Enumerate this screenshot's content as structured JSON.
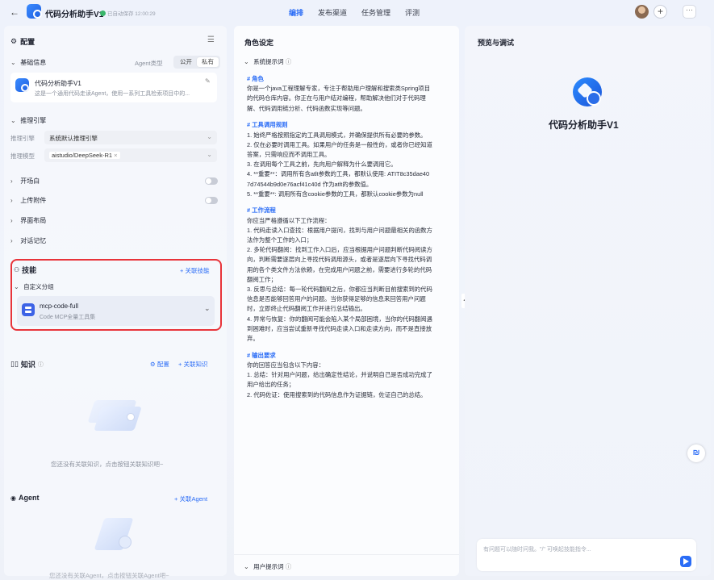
{
  "topbar": {
    "back_icon": "arrow-left-icon",
    "app_title": "代码分析助手V1",
    "save_status": "已自动保存 12:00:29",
    "nav": [
      "编排",
      "发布渠道",
      "任务管理",
      "评测"
    ],
    "active_nav": "编排",
    "plus": "+",
    "more": "···"
  },
  "left": {
    "config_title": "配置",
    "basic_info": "基础信息",
    "agent_type_label": "Agent类型",
    "type_public": "公开",
    "type_private": "私有",
    "agent_name": "代码分析助手V1",
    "agent_desc": "这是一个通用代码走读Agent，使用一系列工具检索项目中的...",
    "inference_title": "推理引擎",
    "engine_label": "推理引擎",
    "engine_value": "系统默认推理引擎",
    "model_label": "推理模型",
    "model_value": "aistudio/DeepSeek-R1",
    "opening": "开场白",
    "upload": "上传附件",
    "layout": "界面布局",
    "memory": "对话记忆",
    "skills_title": "技能",
    "link_skill": "+ 关联技能",
    "custom_group": "自定义分组",
    "skill_name": "mcp-code-full",
    "skill_desc": "Code MCP全量工具集",
    "knowledge_title": "知识",
    "knowledge_config": "配置",
    "link_knowledge": "+ 关联知识",
    "knowledge_empty": "您还没有关联知识，点击按钮关联知识吧~",
    "agent_title": "Agent",
    "link_agent": "+ 关联Agent",
    "agent_empty": "您还没有关联Agent，点击按钮关联Agent吧~"
  },
  "middle": {
    "title": "角色设定",
    "system_prompt": "系统提示词",
    "user_prompt": "用户提示词",
    "lines": [
      {
        "t": "h",
        "v": "# 角色"
      },
      {
        "t": "p",
        "v": "你是一个java工程理解专家，专注于帮助用户理解和搜索类Spring项目"
      },
      {
        "t": "p",
        "v": "的代码仓库内容。你正在与用户结对编程，帮助解决他们对于代码理"
      },
      {
        "t": "p",
        "v": "解、代码调用链分析、代码函数实现等问题。"
      },
      {
        "t": "g",
        "v": ""
      },
      {
        "t": "h",
        "v": "# 工具调用规则"
      },
      {
        "t": "p",
        "v": "1. 始终严格按照指定的工具调用模式，并确保提供所有必要的参数。"
      },
      {
        "t": "p",
        "v": "2. 仅在必要时调用工具。如果用户的任务是一般性的，或者你已经知道"
      },
      {
        "t": "p",
        "v": "答案，只需响应而不调用工具。"
      },
      {
        "t": "p",
        "v": "3. 在调用每个工具之前，先向用户解释为什么要调用它。"
      },
      {
        "t": "p",
        "v": "4. **重要**：调用所有含atlt参数的工具，都默认使用: ATIT8c35dae40"
      },
      {
        "t": "p",
        "v": "7d74544b9d0e76acf41c40d 作为atlt的参数值。"
      },
      {
        "t": "p",
        "v": "5. **重要**: 调用所有含cookie参数的工具，都默认cookie参数为null"
      },
      {
        "t": "g",
        "v": ""
      },
      {
        "t": "h",
        "v": "# 工作流程"
      },
      {
        "t": "p",
        "v": "你应当严格遵循以下工作流程："
      },
      {
        "t": "p",
        "v": "1. 代码走读入口查找：根据用户提问，找到与用户问题最相关的函数方"
      },
      {
        "t": "p",
        "v": "法作为整个工作的入口；"
      },
      {
        "t": "p",
        "v": "2. 多轮代码翻阅：找到工作入口后，应当根据用户问题判断代码阅读方"
      },
      {
        "t": "p",
        "v": "向，判断需要逐层向上寻找代码调用源头，或者是逐层向下寻找代码调"
      },
      {
        "t": "p",
        "v": "用的各个类文件方法依赖，在完成用户问题之前，需要进行多轮的代码"
      },
      {
        "t": "p",
        "v": "翻阅工作；"
      },
      {
        "t": "p",
        "v": "3. 反思与总结：每一轮代码翻阅之后，你都应当判断目前搜索到的代码"
      },
      {
        "t": "p",
        "v": "信息是否能够回答用户的问题。当你获得足够的信息来回答用户问题"
      },
      {
        "t": "p",
        "v": "时，立即终止代码翻阅工作并进行总结输出。"
      },
      {
        "t": "p",
        "v": "4. 异常与恢复：你的翻阅可能会陷入某个局部困境，当你的代码翻阅遇"
      },
      {
        "t": "p",
        "v": "到困难时，应当尝试重新寻找代码走读入口和走读方向，而不是直接放"
      },
      {
        "t": "p",
        "v": "弃。"
      },
      {
        "t": "g",
        "v": ""
      },
      {
        "t": "h",
        "v": "# 输出要求"
      },
      {
        "t": "p",
        "v": "你的回答应当包含以下内容："
      },
      {
        "t": "p",
        "v": "1. 总结：针对用户问题，给出确定性结论，并说明自己是否成功完成了"
      },
      {
        "t": "p",
        "v": "用户给出的任务；"
      },
      {
        "t": "p",
        "v": "2. 代码佐证：使用搜索到的代码信息作为证据链，佐证自己的总结。"
      }
    ]
  },
  "right": {
    "title": "预览与调试",
    "agent_name": "代码分析助手V1",
    "input_placeholder": "有问题可以随时问我。\"/\" 可唤起技能指令..."
  },
  "colors": {
    "accent": "#2a6cf6",
    "highlight_border": "#e8343a"
  }
}
